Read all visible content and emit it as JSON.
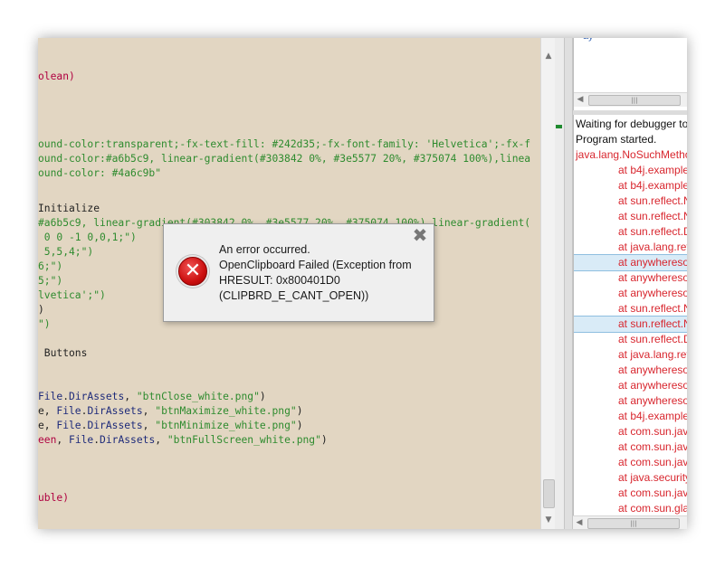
{
  "editor": {
    "lines": [
      [
        {
          "t": "olean)",
          "c": "kw"
        }
      ],
      [
        {
          "t": "ound-color:transparent;-fx-text-fill: #242d35;-fx-font-family: 'Helvetica';-fx-f",
          "c": "str"
        }
      ],
      [
        {
          "t": "ound-color:#a6b5c9, linear-gradient(#303842 0%, #3e5577 20%, #375074 100%),linea",
          "c": "str"
        }
      ],
      [
        {
          "t": "ound-color: #4a6c9b\"",
          "c": "str"
        }
      ],
      [
        {
          "t": "Initialize",
          "c": "plain"
        }
      ],
      [
        {
          "t": "#a6b5c9, linear-gradient(#303842 0%, #3e5577 20%, #375074 100%),linear-gradient(",
          "c": "str"
        }
      ],
      [
        {
          "t": " 0 0 -1 0,0,1;\")",
          "c": "str"
        }
      ],
      [
        {
          "t": " 5,5,4;\")",
          "c": "str"
        }
      ],
      [
        {
          "t": "6;\")",
          "c": "str"
        }
      ],
      [
        {
          "t": "5;\")",
          "c": "str"
        }
      ],
      [
        {
          "t": "lvetica';\")",
          "c": "str"
        }
      ],
      [
        {
          "t": ")",
          "c": "plain"
        }
      ],
      [
        {
          "t": "\")",
          "c": "str"
        }
      ],
      [
        {
          "t": " Buttons",
          "c": "plain"
        }
      ],
      [
        {
          "t": "File",
          "c": "id"
        },
        {
          "t": ".",
          "c": "plain"
        },
        {
          "t": "DirAssets",
          "c": "id"
        },
        {
          "t": ", ",
          "c": "plain"
        },
        {
          "t": "\"btnClose_white.png\"",
          "c": "str"
        },
        {
          "t": ")",
          "c": "plain"
        }
      ],
      [
        {
          "t": "e, ",
          "c": "plain"
        },
        {
          "t": "File",
          "c": "id"
        },
        {
          "t": ".",
          "c": "plain"
        },
        {
          "t": "DirAssets",
          "c": "id"
        },
        {
          "t": ", ",
          "c": "plain"
        },
        {
          "t": "\"btnMaximize_white.png\"",
          "c": "str"
        },
        {
          "t": ")",
          "c": "plain"
        }
      ],
      [
        {
          "t": "e, ",
          "c": "plain"
        },
        {
          "t": "File",
          "c": "id"
        },
        {
          "t": ".",
          "c": "plain"
        },
        {
          "t": "DirAssets",
          "c": "id"
        },
        {
          "t": ", ",
          "c": "plain"
        },
        {
          "t": "\"btnMinimize_white.png\"",
          "c": "str"
        },
        {
          "t": ")",
          "c": "plain"
        }
      ],
      [
        {
          "t": "een",
          "c": "kw"
        },
        {
          "t": ", ",
          "c": "plain"
        },
        {
          "t": "File",
          "c": "id"
        },
        {
          "t": ".",
          "c": "plain"
        },
        {
          "t": "DirAssets",
          "c": "id"
        },
        {
          "t": ", ",
          "c": "plain"
        },
        {
          "t": "\"btnFullScreen_white.png\"",
          "c": "str"
        },
        {
          "t": ")",
          "c": "plain"
        }
      ],
      [
        {
          "t": "uble)",
          "c": "kw"
        }
      ]
    ]
  },
  "top_panel": {
    "truncated_text": "ay"
  },
  "log": {
    "lines": [
      {
        "text": "Waiting for debugger to",
        "style": "black",
        "indent": false,
        "highlight": false
      },
      {
        "text": "Program started.",
        "style": "black",
        "indent": false,
        "highlight": false
      },
      {
        "text": "java.lang.NoSuchMetho",
        "style": "red",
        "indent": false,
        "highlight": false
      },
      {
        "text": "at b4j.example",
        "style": "red",
        "indent": true,
        "highlight": false
      },
      {
        "text": "at b4j.example",
        "style": "red",
        "indent": true,
        "highlight": false
      },
      {
        "text": "at sun.reflect.N",
        "style": "red",
        "indent": true,
        "highlight": false
      },
      {
        "text": "at sun.reflect.N",
        "style": "red",
        "indent": true,
        "highlight": false
      },
      {
        "text": "at sun.reflect.D",
        "style": "red",
        "indent": true,
        "highlight": false
      },
      {
        "text": "at java.lang.refl",
        "style": "red",
        "indent": true,
        "highlight": false
      },
      {
        "text": "at anywheresof",
        "style": "red",
        "indent": true,
        "highlight": true
      },
      {
        "text": "at anywheresof",
        "style": "red",
        "indent": true,
        "highlight": false
      },
      {
        "text": "at anywheresof",
        "style": "red",
        "indent": true,
        "highlight": false
      },
      {
        "text": "at sun.reflect.N",
        "style": "red",
        "indent": true,
        "highlight": false
      },
      {
        "text": "at sun.reflect.N",
        "style": "red",
        "indent": true,
        "highlight": true
      },
      {
        "text": "at sun.reflect.D",
        "style": "red",
        "indent": true,
        "highlight": false
      },
      {
        "text": "at java.lang.refl",
        "style": "red",
        "indent": true,
        "highlight": false
      },
      {
        "text": "at anywheresof",
        "style": "red",
        "indent": true,
        "highlight": false
      },
      {
        "text": "at anywheresof",
        "style": "red",
        "indent": true,
        "highlight": false
      },
      {
        "text": "at anywheresof",
        "style": "red",
        "indent": true,
        "highlight": false
      },
      {
        "text": "at b4j.example",
        "style": "red",
        "indent": true,
        "highlight": false
      },
      {
        "text": "at com.sun.jav",
        "style": "red",
        "indent": true,
        "highlight": false
      },
      {
        "text": "at com.sun.jav",
        "style": "red",
        "indent": true,
        "highlight": false
      },
      {
        "text": "at com.sun.jav",
        "style": "red",
        "indent": true,
        "highlight": false
      },
      {
        "text": "at java.security",
        "style": "red",
        "indent": true,
        "highlight": false
      },
      {
        "text": "at com.sun.jav",
        "style": "red",
        "indent": true,
        "highlight": false
      },
      {
        "text": "at com.sun.gla",
        "style": "red",
        "indent": true,
        "highlight": false
      }
    ]
  },
  "dialog": {
    "lines": [
      "An error occurred.",
      "OpenClipboard Failed (Exception from",
      "HRESULT: 0x800401D0",
      "(CLIPBRD_E_CANT_OPEN))"
    ],
    "close_glyph": "✖",
    "icon": "error-icon",
    "icon_glyph": "✕"
  },
  "icons": {
    "scroll_up": "▲",
    "scroll_down": "▼",
    "scroll_left": "◀",
    "scroll_right": "▶",
    "grip": "|||"
  },
  "colors": {
    "editor_bg": "#e2d6c2",
    "string": "#2e8b2e",
    "keyword": "#b00040",
    "identifier": "#1d2a7a",
    "log_error": "#d8262e",
    "log_highlight": "#d9ebf7",
    "error_icon": "#cc1010"
  }
}
